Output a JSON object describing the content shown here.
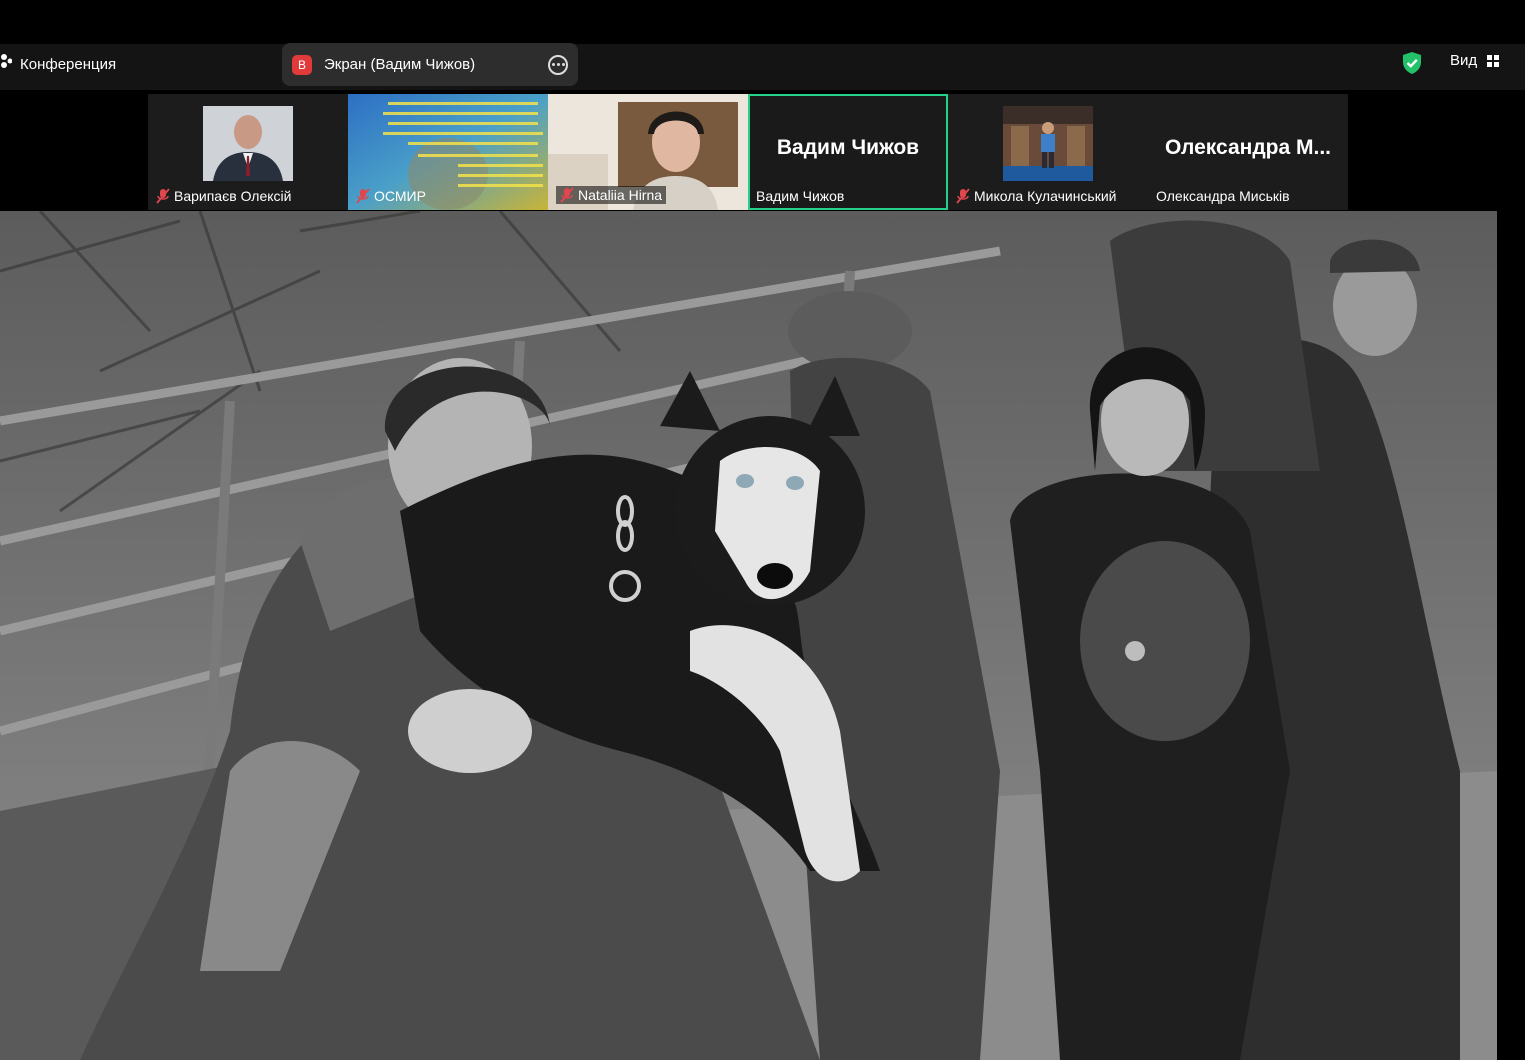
{
  "meeting": {
    "label": "Конференция"
  },
  "share": {
    "avatar_letter": "В",
    "label": "Экран (Вадим Чижов)"
  },
  "toolbar": {
    "view_label": "Вид"
  },
  "participants": [
    {
      "name": "Варипаєв Олексій",
      "muted": true
    },
    {
      "name": "ОСМИР",
      "muted": true
    },
    {
      "name": "Nataliia Hirna",
      "muted": true
    },
    {
      "name": "Вадим Чижов",
      "display": "Вадим Чижов",
      "active": true
    },
    {
      "name": "Микола Кулачинський",
      "muted": true
    },
    {
      "name": "Олександра Миськів",
      "display": "Олександра  М..."
    }
  ],
  "colors": {
    "active_border": "#23d18b",
    "shield": "#21c26a",
    "avatar_red": "#e03a3a"
  }
}
